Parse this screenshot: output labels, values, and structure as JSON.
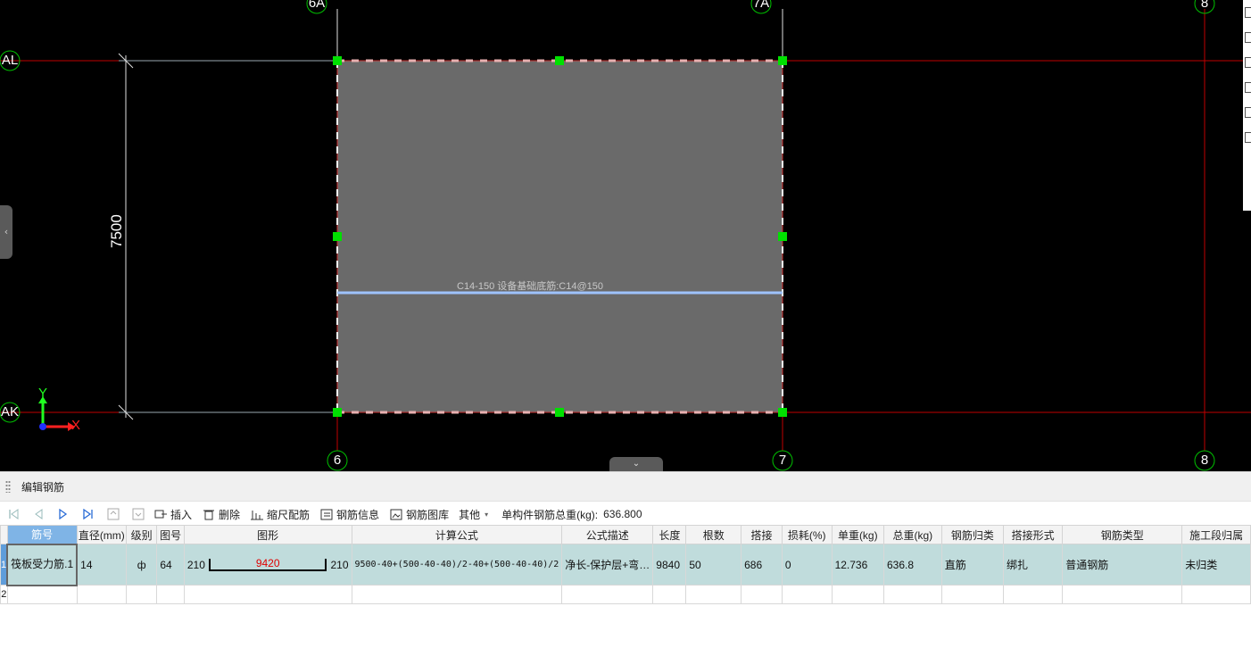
{
  "drawing": {
    "axes_vertical": [
      "6A",
      "7A",
      "8",
      "6",
      "7",
      "8"
    ],
    "axes_horizontal": [
      "AL",
      "AK"
    ],
    "dimension": "7500",
    "rebar_label": "C14-150 设备基础底筋:C14@150",
    "ucs": {
      "x": "X",
      "y": "Y"
    },
    "colors": {
      "background": "#000000",
      "slab": "#6a6a6a",
      "axis_line": "#cc0000",
      "grip": "#00ff00",
      "rebar": "#9ec3ff"
    }
  },
  "panel": {
    "title": "编辑钢筋",
    "toolbar": {
      "nav": [
        "first-icon",
        "prev-icon",
        "next-icon",
        "last-icon"
      ],
      "insert": "插入",
      "delete": "删除",
      "scale_rebar": "缩尺配筋",
      "rebar_info": "钢筋信息",
      "rebar_library": "钢筋图库",
      "other": "其他",
      "total_label": "单构件钢筋总重(kg):",
      "total_value": "636.800"
    },
    "columns": [
      "筋号",
      "直径(mm)",
      "级别",
      "图号",
      "图形",
      "计算公式",
      "公式描述",
      "长度",
      "根数",
      "搭接",
      "损耗(%)",
      "单重(kg)",
      "总重(kg)",
      "钢筋归类",
      "搭接形式",
      "钢筋类型",
      "施工段归属"
    ],
    "rows": [
      {
        "num": "1",
        "name": "筏板受力筋.1",
        "diameter": "14",
        "grade": "ф",
        "figure_no": "64",
        "shape_left": "210",
        "shape_mid": "9420",
        "shape_right": "210",
        "formula": "9500-40+(500-40-40)/2-40+(500-40-40)/2",
        "formula_desc": "净长-保护层+弯…",
        "length": "9840",
        "count": "50",
        "lap": "686",
        "loss": "0",
        "unit_weight": "12.736",
        "total_weight": "636.8",
        "category": "直筋",
        "lap_type": "绑扎",
        "rebar_type": "普通钢筋",
        "stage": "未归类"
      },
      {
        "num": "2",
        "name": "",
        "diameter": "",
        "grade": "",
        "figure_no": "",
        "shape_left": "",
        "shape_mid": "",
        "shape_right": "",
        "formula": "",
        "formula_desc": "",
        "length": "",
        "count": "",
        "lap": "",
        "loss": "",
        "unit_weight": "",
        "total_weight": "",
        "category": "",
        "lap_type": "",
        "rebar_type": "",
        "stage": ""
      }
    ]
  }
}
